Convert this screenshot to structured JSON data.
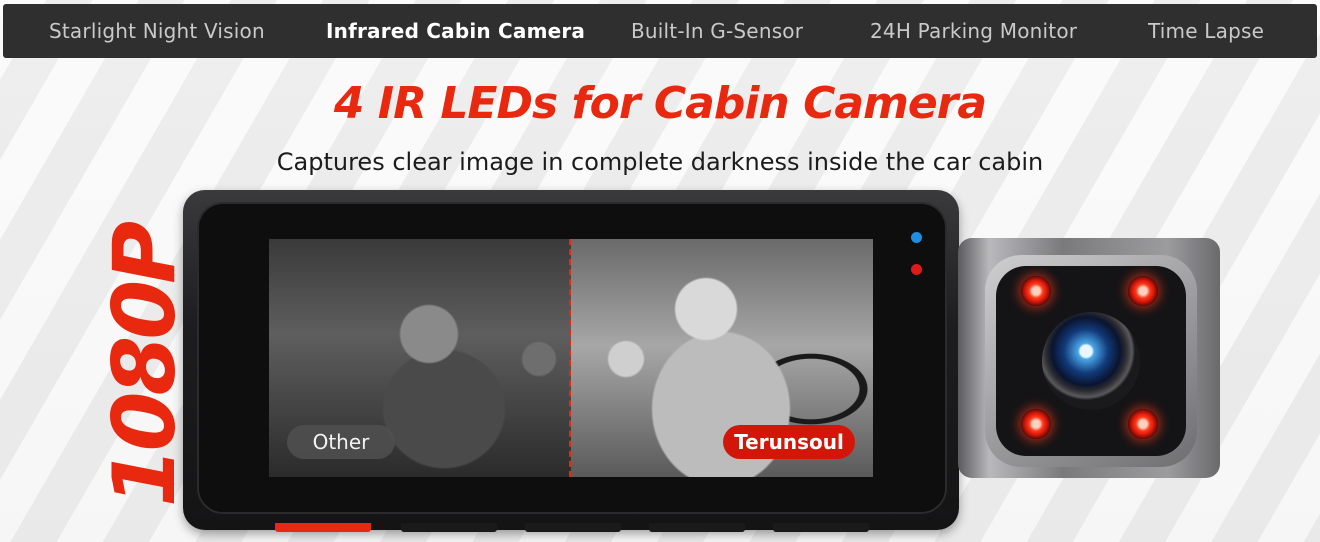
{
  "tabs": [
    {
      "label": "Starlight Night Vision",
      "active": false
    },
    {
      "label": "Infrared Cabin Camera",
      "active": true
    },
    {
      "label": "Built-In G-Sensor",
      "active": false
    },
    {
      "label": "24H Parking Monitor",
      "active": false
    },
    {
      "label": "Time Lapse",
      "active": false
    }
  ],
  "hero": {
    "headline": "4 IR LEDs for Cabin Camera",
    "subheadline": "Captures clear image in complete darkness inside the car cabin",
    "resolution": "1080P"
  },
  "comparison": {
    "left_label": "Other",
    "right_label": "Terunsoul"
  },
  "colors": {
    "accent": "#e8280f",
    "tabbar": "#2f2f2f",
    "brand_badge": "#d3160a"
  },
  "icons": {
    "status_led_blue": "status-led-blue-icon",
    "status_led_red": "status-led-red-icon"
  }
}
